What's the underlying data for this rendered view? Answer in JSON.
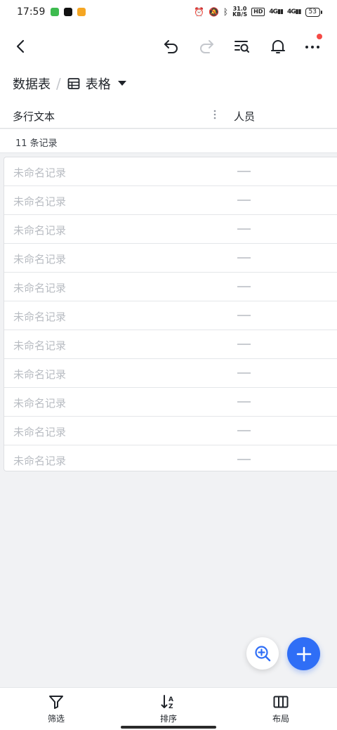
{
  "status_bar": {
    "time": "17:59",
    "network_speed_top": "31.0",
    "network_speed_bottom": "KB/S",
    "hd": "HD",
    "signal1": "4G",
    "signal2": "4G",
    "battery": "53"
  },
  "nav": {
    "back_icon": "chevron-left",
    "undo_icon": "undo",
    "redo_icon": "redo",
    "search_icon": "list-search",
    "bell_icon": "bell",
    "more_icon": "more-horizontal"
  },
  "breadcrumb": {
    "parent": "数据表",
    "separator": "/",
    "view_name": "表格"
  },
  "columns": {
    "primary": "多行文本",
    "secondary": "人员"
  },
  "record_count": "11 条记录",
  "rows": [
    {
      "name": "未命名记录"
    },
    {
      "name": "未命名记录"
    },
    {
      "name": "未命名记录"
    },
    {
      "name": "未命名记录"
    },
    {
      "name": "未命名记录"
    },
    {
      "name": "未命名记录"
    },
    {
      "name": "未命名记录"
    },
    {
      "name": "未命名记录"
    },
    {
      "name": "未命名记录"
    },
    {
      "name": "未命名记录"
    },
    {
      "name": "未命名记录"
    }
  ],
  "bottom_tabs": {
    "filter": "筛选",
    "sort": "排序",
    "layout": "布局"
  },
  "colors": {
    "accent": "#2f6ef6",
    "notification_dot": "#f54a45",
    "placeholder_text": "#b8bcc2"
  }
}
